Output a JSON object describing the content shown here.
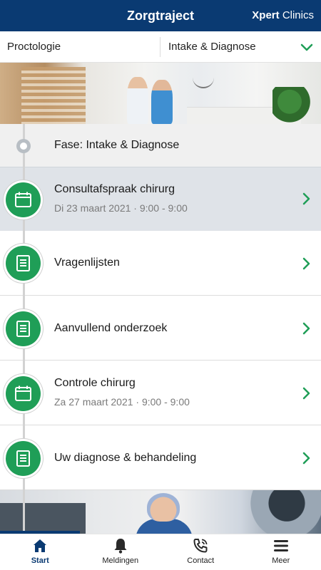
{
  "header": {
    "title": "Zorgtraject",
    "brand_bold": "Xpert",
    "brand_light": "Clinics"
  },
  "filters": {
    "specialty": "Proctologie",
    "phase": "Intake & Diagnose"
  },
  "phase": {
    "label": "Fase: Intake & Diagnose"
  },
  "items": [
    {
      "title": "Consultafspraak chirurg",
      "subtitle": "Di 23 maart 2021 · 9:00 - 9:00",
      "icon": "calendar-icon",
      "active": true
    },
    {
      "title": "Vragenlijsten",
      "subtitle": "",
      "icon": "document-icon",
      "active": false
    },
    {
      "title": "Aanvullend onderzoek",
      "subtitle": "",
      "icon": "document-icon",
      "active": false
    },
    {
      "title": "Controle chirurg",
      "subtitle": "Za 27 maart 2021 · 9:00 - 9:00",
      "icon": "calendar-icon",
      "active": false
    },
    {
      "title": "Uw diagnose & behandeling",
      "subtitle": "",
      "icon": "document-icon",
      "active": false
    }
  ],
  "tabs": [
    {
      "label": "Start",
      "icon": "home-icon",
      "active": true
    },
    {
      "label": "Meldingen",
      "icon": "bell-icon",
      "active": false
    },
    {
      "label": "Contact",
      "icon": "phone-icon",
      "active": false
    },
    {
      "label": "Meer",
      "icon": "menu-icon",
      "active": false
    }
  ],
  "colors": {
    "navy": "#0a3a72",
    "green": "#1f9e57",
    "active_row": "#dfe3e8",
    "phase_bg": "#f0f0f0"
  }
}
